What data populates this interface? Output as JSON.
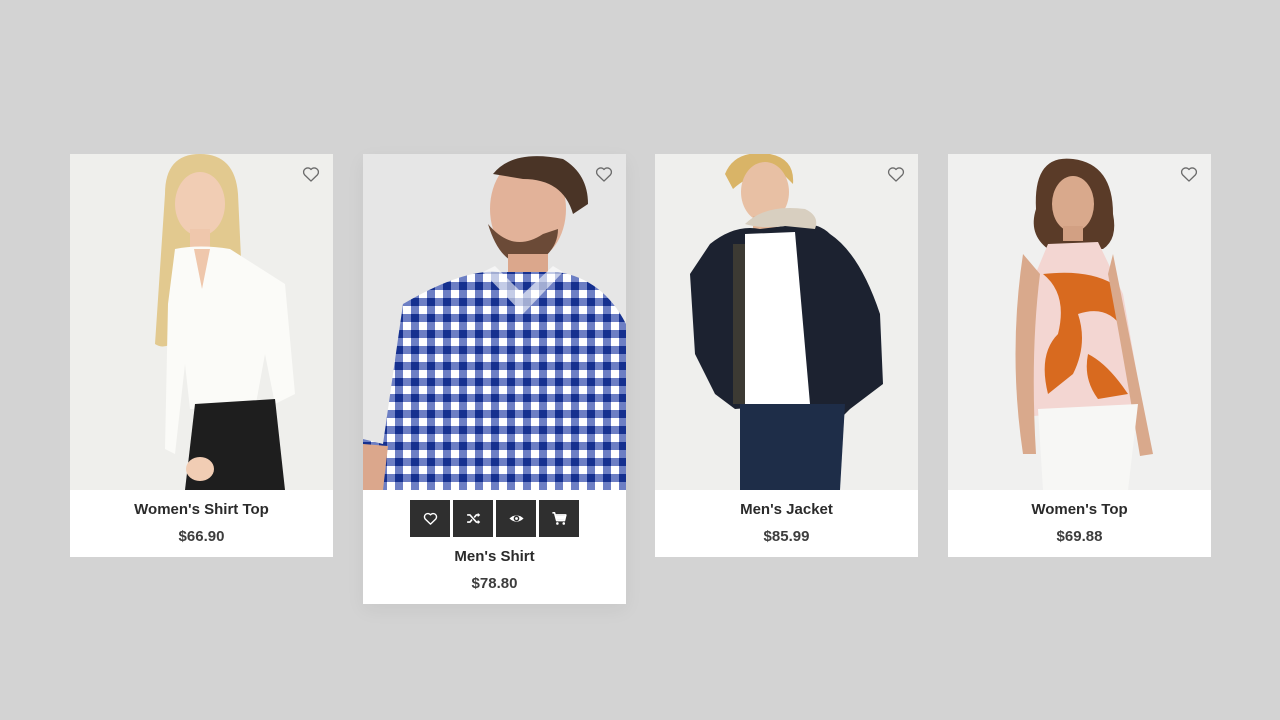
{
  "products": [
    {
      "name": "Women's Shirt Top",
      "price": "$66.90"
    },
    {
      "name": "Men's Shirt",
      "price": "$78.80"
    },
    {
      "name": "Men's Jacket",
      "price": "$85.99"
    },
    {
      "name": "Women's Top",
      "price": "$69.88"
    }
  ],
  "icons": {
    "wishlist": "heart-outline-icon",
    "actions": [
      "heart-icon",
      "shuffle-icon",
      "eye-icon",
      "cart-icon"
    ]
  },
  "colors": {
    "page_bg": "#d3d3d3",
    "card_bg": "#ffffff",
    "action_bg": "#2f2f2f",
    "title": "#2b2b2b"
  }
}
